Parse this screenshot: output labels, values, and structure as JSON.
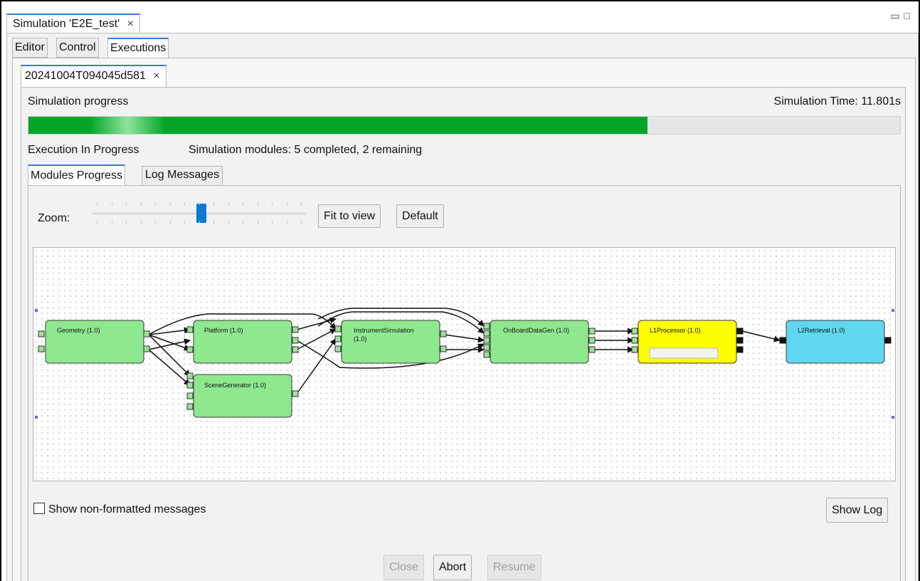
{
  "view_tab": {
    "label": "Simulation 'E2E_test'",
    "close": "×"
  },
  "window_controls": {
    "minimize": "▭",
    "maximize": "□"
  },
  "editor_tabs": [
    "Editor",
    "Control",
    "Executions"
  ],
  "execution_tab": {
    "label": "20241004T094045d581",
    "close": "×"
  },
  "progress": {
    "label": "Simulation progress",
    "time_text": "Simulation Time: 11.801s",
    "fraction": 0.71,
    "fill_color": "#06a52a"
  },
  "status": {
    "state": "Execution In Progress",
    "modules": "Simulation modules: 5 completed, 2 remaining"
  },
  "inner_tabs": [
    "Modules Progress",
    "Log Messages"
  ],
  "zoom": {
    "label": "Zoom:",
    "fit_label": "Fit to view",
    "default_label": "Default",
    "level": 0.5
  },
  "modules": [
    {
      "name": "Geometry (1.0)",
      "state": "completed",
      "color": "#8ee88e"
    },
    {
      "name": "Platform (1.0)",
      "state": "completed",
      "color": "#8ee88e"
    },
    {
      "name": "SceneGenerator (1.0)",
      "state": "completed",
      "color": "#8ee88e"
    },
    {
      "name": "InstrumentSimulation",
      "name2": "(1.0)",
      "state": "completed",
      "color": "#8ee88e"
    },
    {
      "name": "OnBoardDataGen (1.0)",
      "state": "completed",
      "color": "#8ee88e"
    },
    {
      "name": "L1Processor (1.0)",
      "state": "running",
      "color": "#ffff00"
    },
    {
      "name": "L2Retrieval (1.0)",
      "state": "pending",
      "color": "#5fd7ef"
    }
  ],
  "bottom": {
    "checkbox_label": "Show non-formatted messages",
    "checkbox_checked": false,
    "show_log": "Show Log",
    "close": "Close",
    "abort": "Abort",
    "resume": "Resume"
  }
}
